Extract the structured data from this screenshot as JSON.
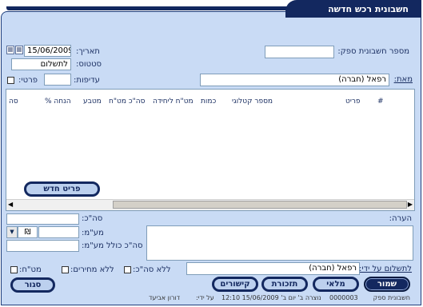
{
  "window": {
    "title": "חשבונית רכש חדשה"
  },
  "form": {
    "invoice_no_label": "מספר חשבונית ספק:",
    "invoice_no_value": "",
    "date_label": "תאריך:",
    "date_value": "15/06/2009",
    "status_label": "סטטוס:",
    "status_value": "לתשלום",
    "priority_label": "עדיפות:",
    "priority_value": "",
    "private_label": "פרטי:",
    "from_label": "מאת:",
    "from_value": "רפאל (חברה)"
  },
  "grid": {
    "columns": [
      "#",
      "פריט",
      "מספר קטלוגי",
      "כמות",
      "מט\"ח ליחידה",
      "סה\"כ מט\"ח",
      "מטבע",
      "% הנחה",
      "סה"
    ],
    "new_item_button": "פריט חדש"
  },
  "totals": {
    "note_label": "הערה:",
    "note_value": "",
    "total_label": "סה\"כ:",
    "total_value": "",
    "vat_label": "מע\"מ:",
    "vat_value": "",
    "vat_currency": "₪",
    "total_with_vat_label": "סה\"כ כולל מע\"מ:",
    "total_with_vat_value": ""
  },
  "payment": {
    "pay_by_label": "לתשלום על ידי:",
    "pay_by_value": "רפאל (חברה)",
    "no_total_label": "ללא סה\"כ:",
    "no_prices_label": "ללא מחירים:",
    "fx_label": "מט\"ח:"
  },
  "buttons": {
    "save": "שמור",
    "fill": "מלאי",
    "reminders": "תזכורת",
    "links": "קישורים",
    "close": "סגור"
  },
  "status_bar": {
    "left_label": "חשבונית ספק",
    "record_no": "0000003",
    "created_text": "נוצרה ב' יום ב' 15/06/2009 12:10",
    "by_label": "על ידי:",
    "by_value": "דורון אביעד"
  }
}
